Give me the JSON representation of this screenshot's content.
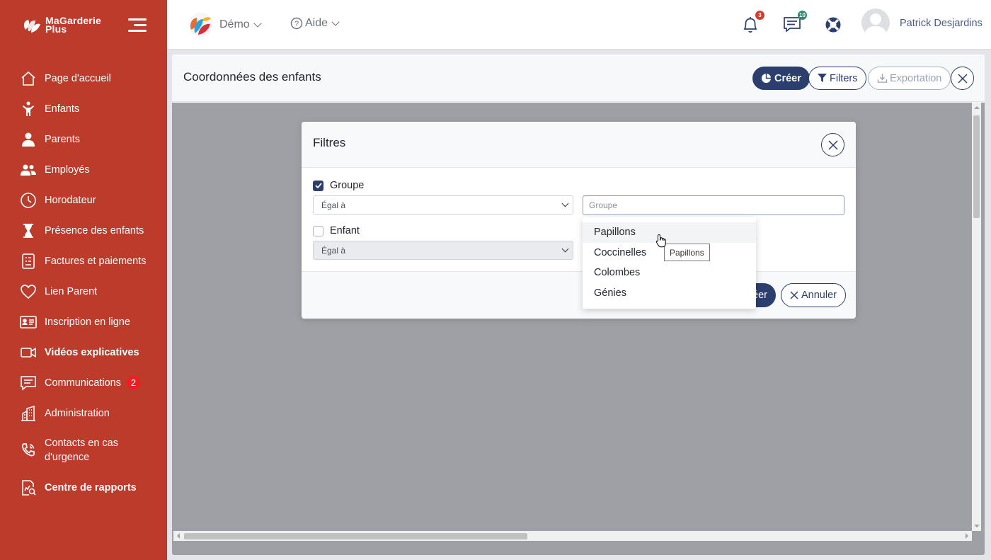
{
  "brand": {
    "line1": "MaGarderie",
    "line2": "Plus"
  },
  "sidebar": {
    "items": [
      {
        "label": "Page d'accueil",
        "icon": "home-icon"
      },
      {
        "label": "Enfants",
        "icon": "child-icon"
      },
      {
        "label": "Parents",
        "icon": "parent-icon"
      },
      {
        "label": "Employés",
        "icon": "employees-icon"
      },
      {
        "label": "Horodateur",
        "icon": "clock-icon"
      },
      {
        "label": "Présence des enfants",
        "icon": "hourglass-icon"
      },
      {
        "label": "Factures et paiements",
        "icon": "invoice-icon"
      },
      {
        "label": "Lien Parent",
        "icon": "heart-icon"
      },
      {
        "label": "Inscription en ligne",
        "icon": "id-card-icon"
      },
      {
        "label": "Vidéos explicatives",
        "icon": "video-icon"
      },
      {
        "label": "Communications",
        "icon": "message-icon",
        "badge": "2"
      },
      {
        "label": "Administration",
        "icon": "building-icon"
      },
      {
        "label": "Contacts en cas d'urgence",
        "icon": "phone-icon"
      },
      {
        "label": "Centre de rapports",
        "icon": "report-icon"
      }
    ]
  },
  "topbar": {
    "demo_label": "Démo",
    "help_label": "Aide",
    "notifications_count": "3",
    "messages_count": "10",
    "user_name": "Patrick Desjardins"
  },
  "page": {
    "title": "Coordonnées des enfants",
    "create_label": "Créer",
    "filters_label": "Filters",
    "export_label": "Exportation"
  },
  "modal": {
    "title": "Filtres",
    "group": {
      "label": "Groupe",
      "checked": true,
      "operator": "Égal à",
      "placeholder": "Groupe"
    },
    "child": {
      "label": "Enfant",
      "checked": false,
      "operator": "Égal à"
    },
    "create_label": "Créer",
    "create_visible": "éer",
    "cancel_label": "Annuler"
  },
  "dropdown": {
    "options": [
      "Papillons",
      "Coccinelles",
      "Colombes",
      "Génies"
    ],
    "tooltip": "Papillons"
  },
  "colors": {
    "sidebar": "#bd3b2b",
    "primary": "#2c3e6e",
    "badge_red": "#ee1c24",
    "notif_badge": "#d93b2b",
    "msg_badge": "#2d8a6a"
  }
}
